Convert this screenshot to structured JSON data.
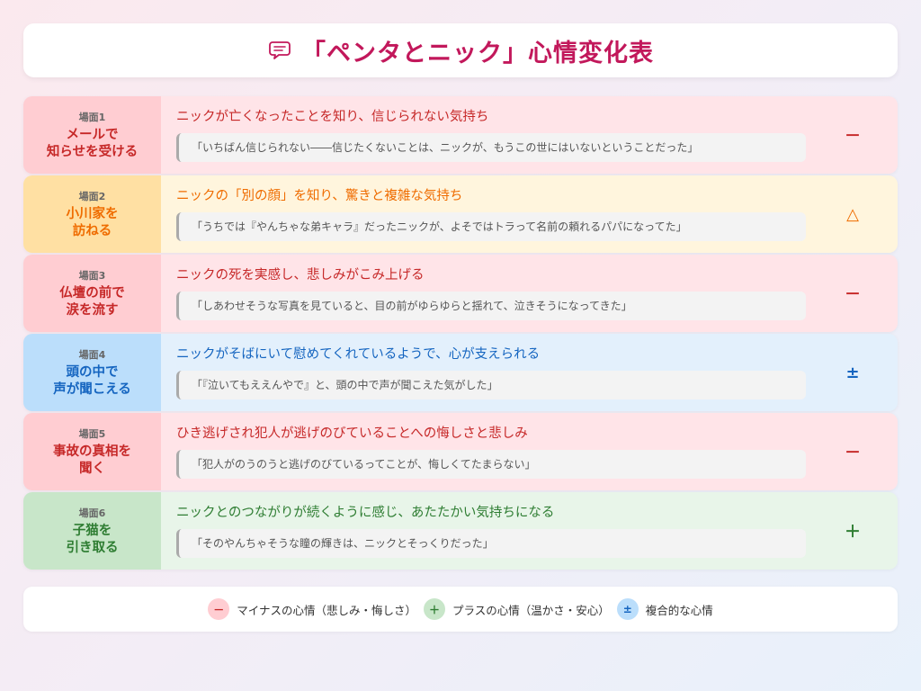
{
  "title": "「ペンタとニック」心情変化表",
  "icons": {
    "title": "speech-bubble-icon"
  },
  "scenes": [
    {
      "num": "場面1",
      "title_l1": "メールで",
      "title_l2": "知らせを受ける",
      "emotion": "ニックが亡くなったことを知り、信じられない気持ち",
      "quote": "「いちばん信じられない――信じたくないことは、ニックが、もうこの世にはいないということだった」",
      "mark": "－",
      "tone": "negative",
      "label_bg": "#ffcdd2",
      "body_bg": "#ffe4e8",
      "title_color": "#c62828",
      "emotion_color": "#c62828",
      "mark_color": "#c62828"
    },
    {
      "num": "場面2",
      "title_l1": "小川家を",
      "title_l2": "訪ねる",
      "emotion": "ニックの「別の顔」を知り、驚きと複雑な気持ち",
      "quote": "「うちでは『やんちゃな弟キャラ』だったニックが、よそではトラって名前の頼れるパパになってた」",
      "mark": "△",
      "tone": "mixed",
      "label_bg": "#ffe0a3",
      "body_bg": "#fff5dd",
      "title_color": "#ef6c00",
      "emotion_color": "#ef6c00",
      "mark_color": "#ef6c00"
    },
    {
      "num": "場面3",
      "title_l1": "仏壇の前で",
      "title_l2": "涙を流す",
      "emotion": "ニックの死を実感し、悲しみがこみ上げる",
      "quote": "「しあわせそうな写真を見ていると、目の前がゆらゆらと揺れて、泣きそうになってきた」",
      "mark": "－",
      "tone": "negative",
      "label_bg": "#ffcdd2",
      "body_bg": "#ffe4e8",
      "title_color": "#c62828",
      "emotion_color": "#c62828",
      "mark_color": "#c62828"
    },
    {
      "num": "場面4",
      "title_l1": "頭の中で",
      "title_l2": "声が聞こえる",
      "emotion": "ニックがそばにいて慰めてくれているようで、心が支えられる",
      "quote": "「『泣いてもええんやで』と、頭の中で声が聞こえた気がした」",
      "mark": "±",
      "tone": "complex",
      "label_bg": "#bbdefb",
      "body_bg": "#e3f0fc",
      "title_color": "#1565c0",
      "emotion_color": "#1565c0",
      "mark_color": "#1565c0"
    },
    {
      "num": "場面5",
      "title_l1": "事故の真相を",
      "title_l2": "聞く",
      "emotion": "ひき逃げされ犯人が逃げのびていることへの悔しさと悲しみ",
      "quote": "「犯人がのうのうと逃げのびているってことが、悔しくてたまらない」",
      "mark": "－",
      "tone": "negative",
      "label_bg": "#ffcdd2",
      "body_bg": "#ffe4e8",
      "title_color": "#c62828",
      "emotion_color": "#c62828",
      "mark_color": "#c62828"
    },
    {
      "num": "場面6",
      "title_l1": "子猫を",
      "title_l2": "引き取る",
      "emotion": "ニックとのつながりが続くように感じ、あたたかい気持ちになる",
      "quote": "「そのやんちゃそうな瞳の輝きは、ニックとそっくりだった」",
      "mark": "＋",
      "tone": "positive",
      "label_bg": "#c8e6c9",
      "body_bg": "#e8f5e9",
      "title_color": "#2e7d32",
      "emotion_color": "#2e7d32",
      "mark_color": "#2e7d32"
    }
  ],
  "legend": [
    {
      "symbol": "－",
      "text": "マイナスの心情（悲しみ・悔しさ）",
      "dot_bg": "#ffcdd2",
      "dot_color": "#c62828"
    },
    {
      "symbol": "＋",
      "text": "プラスの心情（温かさ・安心）",
      "dot_bg": "#c8e6c9",
      "dot_color": "#2e7d32"
    },
    {
      "symbol": "±",
      "text": "複合的な心情",
      "dot_bg": "#bbdefb",
      "dot_color": "#1565c0"
    }
  ]
}
